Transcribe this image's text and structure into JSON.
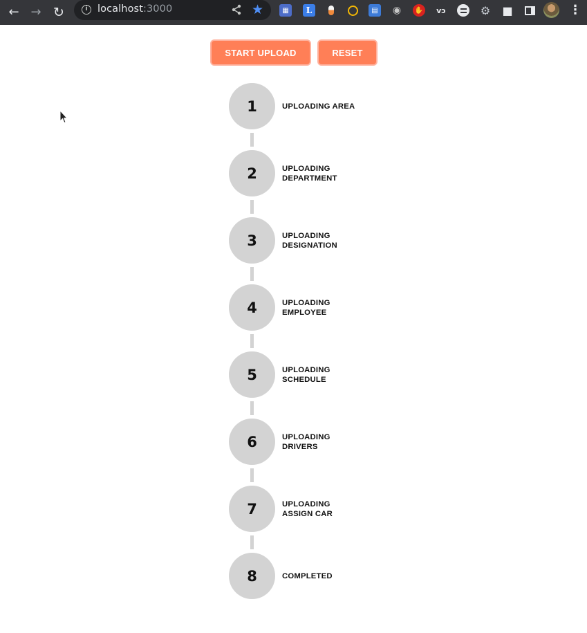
{
  "browser": {
    "url_host": "localhost",
    "url_port": ":3000",
    "icons": {
      "back": "back-arrow-icon",
      "forward": "forward-arrow-icon",
      "reload": "reload-icon",
      "info": "info-icon",
      "share": "share-icon",
      "bookmark": "star-icon",
      "extensions": "puzzle-icon",
      "menu": "kebab-menu-icon"
    },
    "extension_glyphs": {
      "ext2": "L",
      "ext8": "vɔ"
    }
  },
  "toolbar": {
    "start_label": "START UPLOAD",
    "reset_label": "RESET"
  },
  "steps": [
    {
      "number": "1",
      "label": "UPLOADING AREA"
    },
    {
      "number": "2",
      "label": "UPLOADING\nDEPARTMENT"
    },
    {
      "number": "3",
      "label": "UPLOADING\nDESIGNATION"
    },
    {
      "number": "4",
      "label": "UPLOADING\nEMPLOYEE"
    },
    {
      "number": "5",
      "label": "UPLOADING\nSCHEDULE"
    },
    {
      "number": "6",
      "label": "UPLOADING\nDRIVERS"
    },
    {
      "number": "7",
      "label": "UPLOADING\nASSIGN CAR"
    },
    {
      "number": "8",
      "label": "COMPLETED"
    }
  ],
  "colors": {
    "button": "#ff7f57",
    "step_circle": "#d3d3d3",
    "chrome_bar": "#35363a"
  }
}
